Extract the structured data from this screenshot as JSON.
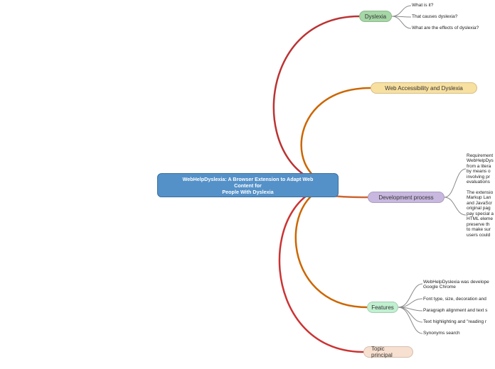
{
  "root": {
    "title_line1": "WebHelpDyslexia: A Browser Extension to Adapt Web",
    "title_line2": "Content for",
    "title_line3": "People With Dyslexia"
  },
  "branches": {
    "dyslexia": {
      "label": "Dyslexia",
      "children": {
        "c1": "What is it?",
        "c2": "That causes dyslexia?",
        "c3": "What are the effects of dyslexia?"
      }
    },
    "web": {
      "label": "Web Accessibility and Dyslexia"
    },
    "dev": {
      "label": "Development process",
      "children": {
        "p1": "Requirement\nWebHelpDys\nfrom a litera\nby means o\ninvolving pr\nevaluations",
        "p2": "The extensio\nMarkup Lan\nand JavaScr\noriginal pag\npay special a\nHTML eleme\npreserve th\nto make sur\nusers could"
      }
    },
    "features": {
      "label": "Features",
      "children": {
        "f1": "WebHelpDyslexia was develope\nGoogle Chrome",
        "f2": "Font type, size, decoration and",
        "f3": "Paragraph alignment and text s",
        "f4": "Text highlighting and \"reading r",
        "f5": "Synonyms search"
      }
    },
    "topic": {
      "label": "Topic principal"
    }
  }
}
